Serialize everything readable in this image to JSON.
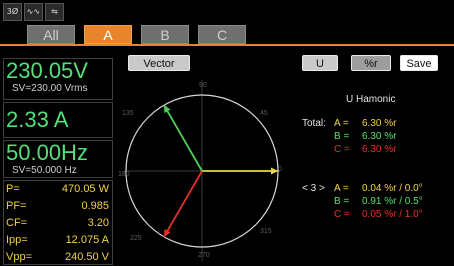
{
  "status_icons": [
    {
      "name": "phase-3-icon",
      "text": "3Ø"
    },
    {
      "name": "ac-wave-icon",
      "text": "∿∿"
    },
    {
      "name": "usb-icon",
      "text": "⇋"
    }
  ],
  "tabs": [
    {
      "label": "All",
      "active": false
    },
    {
      "label": "A",
      "active": true
    },
    {
      "label": "B",
      "active": false
    },
    {
      "label": "C",
      "active": false
    }
  ],
  "voltage": {
    "value": "230.05V",
    "setting": "SV=230.00 Vrms"
  },
  "current": {
    "value": "2.33 A"
  },
  "frequency": {
    "value": "50.00Hz",
    "setting": "SV=50.000  Hz"
  },
  "stats": [
    {
      "label": "P=",
      "value": "470.05 W"
    },
    {
      "label": "PF=",
      "value": "0.985"
    },
    {
      "label": "CF=",
      "value": "3.20"
    },
    {
      "label": "Ipp=",
      "value": "12.075 A"
    },
    {
      "label": "Vpp=",
      "value": "240.50 V"
    }
  ],
  "buttons": {
    "vector": "Vector",
    "u": "U",
    "percent": "%r",
    "save": "Save"
  },
  "vector_plot": {
    "angle_labels": [
      "90",
      "45",
      "0",
      "315",
      "270",
      "225",
      "180",
      "135"
    ],
    "vectors": [
      {
        "phase": "A",
        "angle_deg": 0,
        "color": "#e6d84a"
      },
      {
        "phase": "B",
        "angle_deg": 120,
        "color": "#4fcf5a"
      },
      {
        "phase": "C",
        "angle_deg": 240,
        "color": "#e0322a"
      }
    ]
  },
  "harmonic": {
    "title": "U Hamonic",
    "total": {
      "label": "Total:",
      "rows": [
        {
          "phase": "A =",
          "value": "6.30 %r"
        },
        {
          "phase": "B =",
          "value": "6.30 %r"
        },
        {
          "phase": "C =",
          "value": "6.30 %r"
        }
      ]
    },
    "order": {
      "label": "< 3 >",
      "rows": [
        {
          "phase": "A =",
          "value": "0.04 %r  /  0.0°"
        },
        {
          "phase": "B =",
          "value": "0.91 %r  /  0.5°"
        },
        {
          "phase": "C =",
          "value": "0.05 %r  /  1.0°"
        }
      ]
    }
  }
}
